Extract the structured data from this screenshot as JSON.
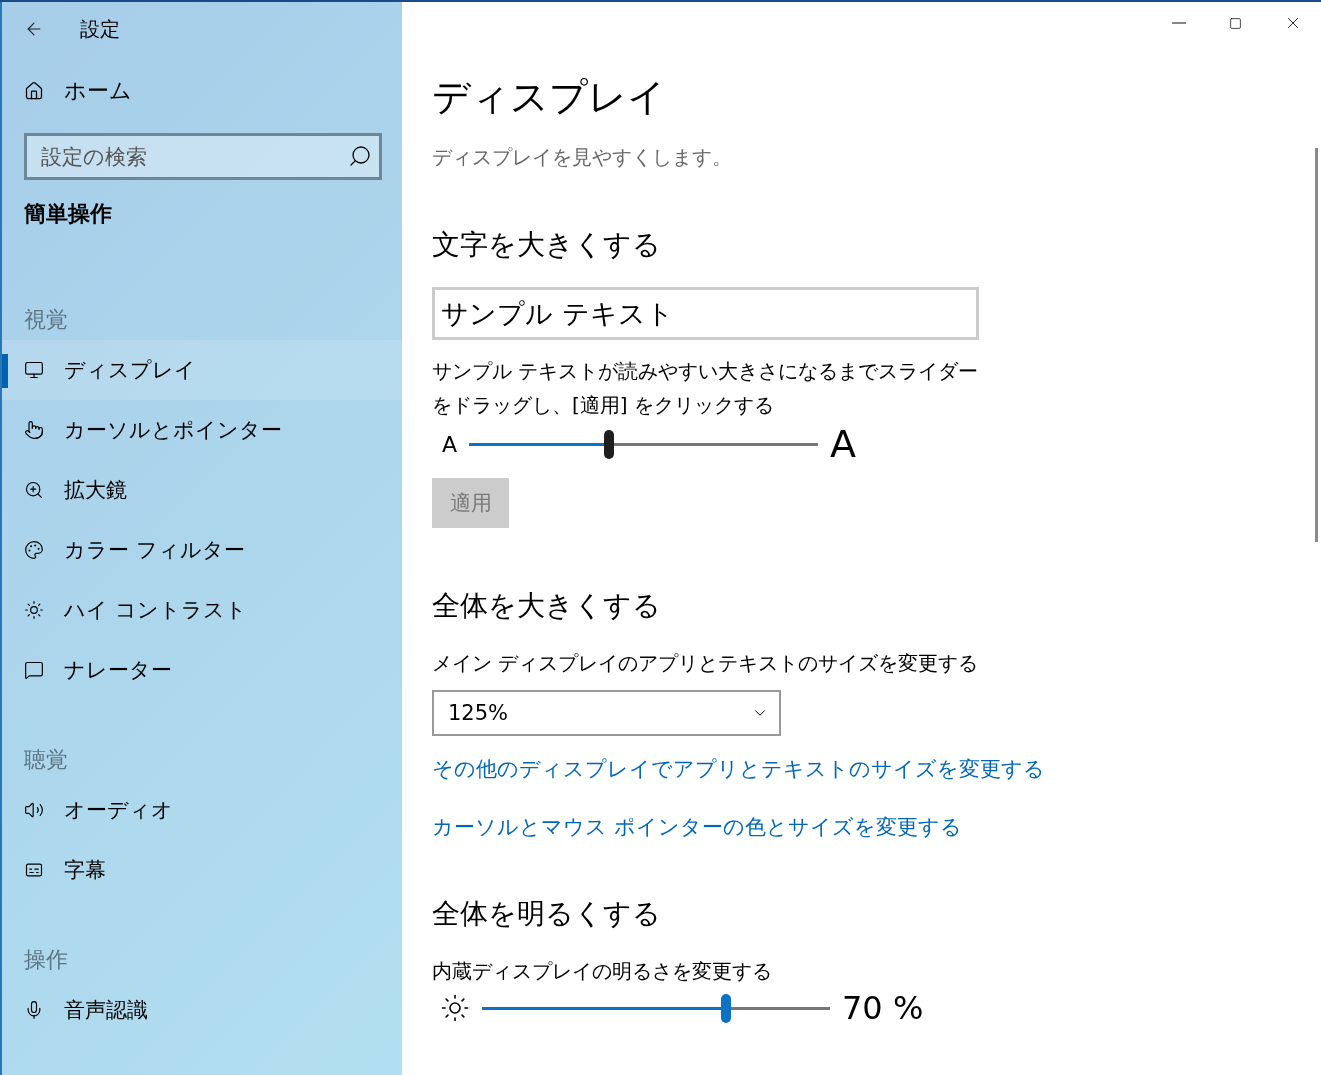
{
  "sidebar": {
    "title": "設定",
    "home": "ホーム",
    "search": {
      "placeholder": "設定の検索"
    },
    "category": "簡単操作",
    "groups": [
      {
        "heading": "視覚",
        "items": [
          {
            "label": "ディスプレイ",
            "selected": true
          },
          {
            "label": "カーソルとポインター",
            "selected": false
          },
          {
            "label": "拡大鏡",
            "selected": false
          },
          {
            "label": "カラー フィルター",
            "selected": false
          },
          {
            "label": "ハイ コントラスト",
            "selected": false
          },
          {
            "label": "ナレーター",
            "selected": false
          }
        ]
      },
      {
        "heading": "聴覚",
        "items": [
          {
            "label": "オーディオ",
            "selected": false
          },
          {
            "label": "字幕",
            "selected": false
          }
        ]
      },
      {
        "heading": "操作",
        "items": [
          {
            "label": "音声認識",
            "selected": false
          }
        ]
      }
    ]
  },
  "main": {
    "title": "ディスプレイ",
    "subtitle": "ディスプレイを見やすくします。",
    "text_size": {
      "heading": "文字を大きくする",
      "sample_text": "サンプル テキスト",
      "description": "サンプル テキストが読みやすい大きさになるまでスライダーをドラッグし、[適用] をクリックする",
      "slider": {
        "small_label": "A",
        "large_label": "A",
        "level": 0.4
      },
      "apply_button": {
        "label": "適用",
        "disabled": true
      }
    },
    "scale": {
      "heading": "全体を大きくする",
      "label": "メイン ディスプレイのアプリとテキストのサイズを変更する",
      "dropdown": {
        "value": "125%"
      },
      "links": [
        "その他のディスプレイでアプリとテキストのサイズを変更する",
        "カーソルとマウス ポインターの色とサイズを変更する"
      ]
    },
    "brightness": {
      "heading": "全体を明るくする",
      "label": "内蔵ディスプレイの明るさを変更する",
      "slider": {
        "level": 0.7,
        "reading": "70 %"
      }
    }
  }
}
